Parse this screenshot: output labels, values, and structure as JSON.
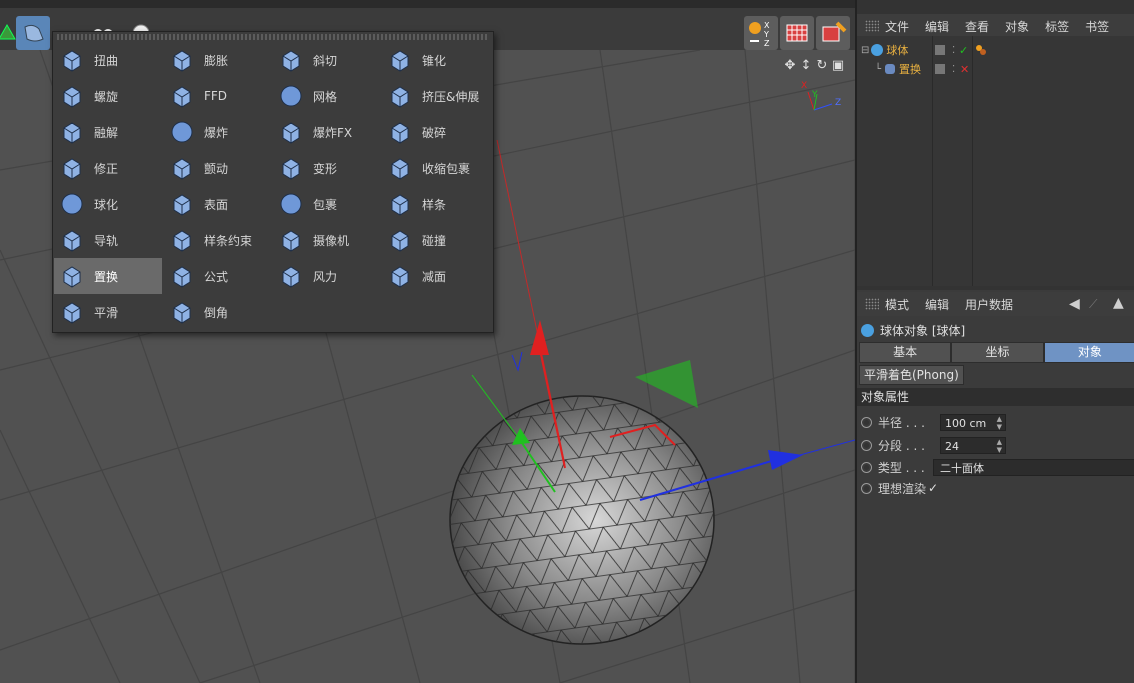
{
  "colors": {
    "accent": "#5a86b8",
    "tab_active": "#6f93c4",
    "axis_x": "#e02020",
    "axis_y": "#20c020",
    "axis_z": "#2040e0",
    "object_name": "#e8b040"
  },
  "toolbar": {
    "buttons": [
      {
        "icon": "cube-generators-icon"
      },
      {
        "icon": "deformer-bend-icon"
      },
      {
        "icon": "spline-icon"
      },
      {
        "icon": "camera-icon"
      },
      {
        "icon": "light-icon"
      }
    ],
    "right_buttons": [
      {
        "icon": "coordinate-system-icon",
        "label": "XYZ"
      },
      {
        "icon": "render-view-icon"
      },
      {
        "icon": "render-settings-icon"
      }
    ]
  },
  "viewport": {
    "nav_icons": [
      "move-view-icon",
      "dolly-view-icon",
      "rotate-view-icon",
      "toggle-view-icon"
    ],
    "axis_labels": {
      "x": "X",
      "y": "Y",
      "z": "Z"
    }
  },
  "deformer_menu": {
    "columns": [
      [
        {
          "label": "扭曲",
          "icon": "bend-icon"
        },
        {
          "label": "螺旋",
          "icon": "twist-icon"
        },
        {
          "label": "融解",
          "icon": "melt-icon"
        },
        {
          "label": "修正",
          "icon": "correction-icon"
        },
        {
          "label": "球化",
          "icon": "spherify-icon"
        },
        {
          "label": "导轨",
          "icon": "rail-icon"
        },
        {
          "label": "置换",
          "icon": "displacer-icon",
          "hover": true
        },
        {
          "label": "平滑",
          "icon": "smoothing-icon"
        }
      ],
      [
        {
          "label": "膨胀",
          "icon": "bulge-icon"
        },
        {
          "label": "FFD",
          "icon": "ffd-icon"
        },
        {
          "label": "爆炸",
          "icon": "explosion-icon"
        },
        {
          "label": "颤动",
          "icon": "jiggle-icon"
        },
        {
          "label": "表面",
          "icon": "surface-icon"
        },
        {
          "label": "样条约束",
          "icon": "spline-wrap-icon"
        },
        {
          "label": "公式",
          "icon": "formula-icon"
        },
        {
          "label": "倒角",
          "icon": "bevel-icon"
        }
      ],
      [
        {
          "label": "斜切",
          "icon": "shear-icon"
        },
        {
          "label": "网格",
          "icon": "mesh-icon"
        },
        {
          "label": "爆炸FX",
          "icon": "explosion-fx-icon"
        },
        {
          "label": "变形",
          "icon": "morph-icon"
        },
        {
          "label": "包裹",
          "icon": "wrap-icon"
        },
        {
          "label": "摄像机",
          "icon": "camera-deformer-icon"
        },
        {
          "label": "风力",
          "icon": "wind-icon"
        }
      ],
      [
        {
          "label": "锥化",
          "icon": "taper-icon"
        },
        {
          "label": "挤压&伸展",
          "icon": "squash-stretch-icon"
        },
        {
          "label": "破碎",
          "icon": "shatter-icon"
        },
        {
          "label": "收缩包裹",
          "icon": "shrink-wrap-icon"
        },
        {
          "label": "样条",
          "icon": "spline-deformer-icon"
        },
        {
          "label": "碰撞",
          "icon": "collision-icon"
        },
        {
          "label": "减面",
          "icon": "polygon-reduction-icon"
        }
      ]
    ]
  },
  "object_manager": {
    "menu": [
      "文件",
      "编辑",
      "查看",
      "对象",
      "标签",
      "书签"
    ],
    "objects": [
      {
        "name": "球体",
        "icon": "sphere-object-icon",
        "tag_icon": "phong-tag-icon",
        "status": "enabled"
      },
      {
        "name": "置换",
        "icon": "displacer-object-icon",
        "status": "disabled"
      }
    ]
  },
  "attribute_manager": {
    "menu": [
      "模式",
      "编辑",
      "用户数据"
    ],
    "object_title": "球体对象 [球体]",
    "tabs": [
      {
        "label": "基本",
        "active": false
      },
      {
        "label": "坐标",
        "active": false
      },
      {
        "label": "对象",
        "active": true
      }
    ],
    "chip": "平滑着色(Phong)",
    "section": "对象属性",
    "properties": [
      {
        "label": "半径 . . .",
        "value": "100 cm",
        "spinner": true
      },
      {
        "label": "分段 . . .",
        "value": "24",
        "spinner": true
      },
      {
        "label": "类型 . . .",
        "value": "二十面体",
        "spinner": false
      },
      {
        "label": "理想渲染",
        "value": "✓",
        "checkbox": true
      }
    ]
  }
}
